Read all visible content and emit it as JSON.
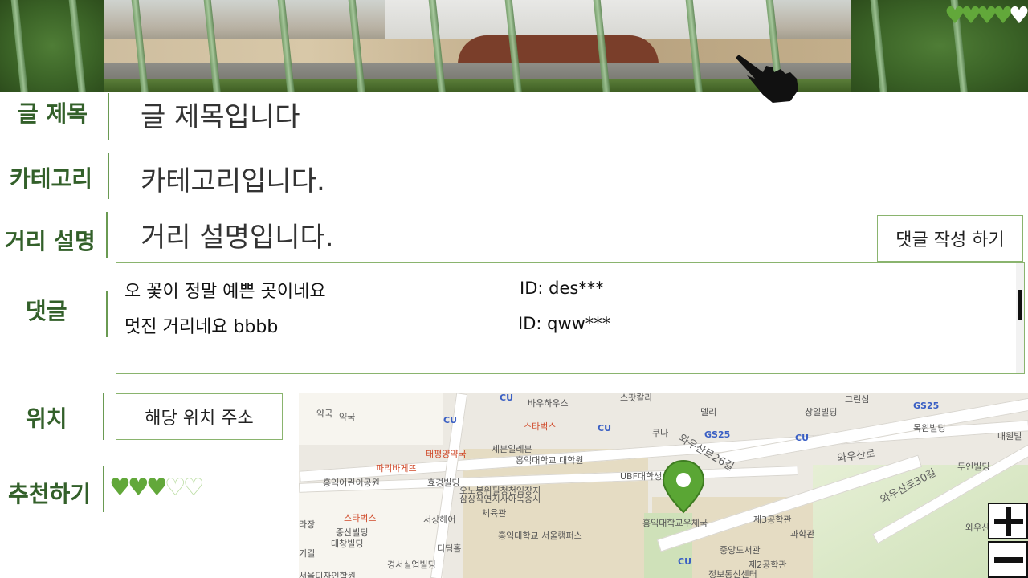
{
  "header": {
    "favorite_hearts": [
      "filled",
      "filled",
      "filled",
      "filled",
      "empty"
    ],
    "heart_color": "#62a83a",
    "cursor_icon": "pointing-hand-icon"
  },
  "fields": {
    "title_label": "글 제목",
    "title_value": "글 제목입니다",
    "category_label": "카테고리",
    "category_value": "카테고리입니다.",
    "description_label": "거리 설명",
    "description_value": "거리 설명입니다."
  },
  "comments": {
    "label": "댓글",
    "write_button": "댓글 작성 하기",
    "items": [
      {
        "text": "오 꽃이 정말 예쁜 곳이네요",
        "id": "ID: des***"
      },
      {
        "text": "멋진 거리네요 bbbb",
        "id": "ID: qww***"
      }
    ]
  },
  "location": {
    "label": "위치",
    "address_button": "해당 위치 주소"
  },
  "recommend": {
    "label": "추천하기",
    "hearts": [
      "filled",
      "filled",
      "filled",
      "empty",
      "empty"
    ],
    "rating": 3,
    "max": 5
  },
  "map": {
    "labels": {
      "l1": "바우하우스",
      "l2": "스팟칼라",
      "l3": "그린섬",
      "l4": "GS25",
      "l5": "CU",
      "l6": "스타벅스",
      "l7": "델리",
      "l8": "창일빌딩",
      "l9": "쿠나",
      "l10": "GS25",
      "l11": "목원빌딩",
      "l12": "대원빌",
      "l13": "태평양약국",
      "l14": "세븐일레븐",
      "l15": "홍익대학교 대학원",
      "l16": "와우산로26길",
      "l17": "파리바게뜨",
      "l18": "UBF대학생선교회",
      "l19": "와우산로",
      "l20": "두인빌딩",
      "l21": "홍익어린이공원",
      "l22": "효경빌딩",
      "l23": "오노봉위필청천임장지",
      "l24": "삼상작연지사아목중시",
      "l25": "와우산로30길",
      "l26": "스타벅스",
      "l27": "서상헤어",
      "l28": "체육관",
      "l29": "홍익대학교우체국",
      "l30": "제3공학관",
      "l31": "과학관",
      "l32": "와우산",
      "l33": "중산빌딩",
      "l34": "홍익대학교 서울캠퍼스",
      "l35": "대창빌딩",
      "l36": "디딤홀",
      "l37": "중앙도서관",
      "l38": "CU",
      "l39": "경서실업빌딩",
      "l40": "제2공학관",
      "l41": "서울디자인학원",
      "l42": "정보통신센터",
      "l43": "CU",
      "l44": "CU",
      "l45": "CU",
      "l46": "약국",
      "l47": "약국",
      "l48": "라장",
      "l49": "기길"
    },
    "zoom_in": "+",
    "zoom_out": "−",
    "pin_icon": "location-pin-icon"
  }
}
